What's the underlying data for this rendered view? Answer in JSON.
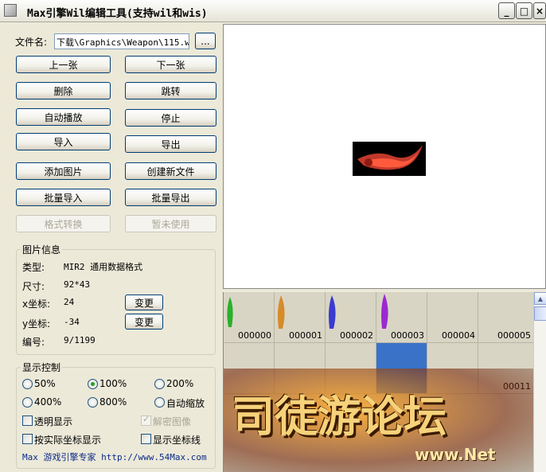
{
  "window": {
    "title": "Max引擎Wil编辑工具(支持wil和wis)",
    "minimize": "_",
    "maximize": "□",
    "close": "×"
  },
  "file": {
    "label": "文件名:",
    "path": "下载\\Graphics\\Weapon\\115.wil",
    "browse": "..."
  },
  "buttons": {
    "prev": "上一张",
    "next": "下一张",
    "delete": "删除",
    "jump": "跳转",
    "autoplay": "自动播放",
    "stop": "停止",
    "import": "导入",
    "export": "导出",
    "add_image": "添加图片",
    "new_file": "创建新文件",
    "batch_import": "批量导入",
    "batch_export": "批量导出",
    "format_convert": "格式转换",
    "unused": "暂未使用"
  },
  "info": {
    "title": "图片信息",
    "type_label": "类型:",
    "type_value": "MIR2  通用数据格式",
    "size_label": "尺寸:",
    "size_value": "92*43",
    "x_label": "x坐标:",
    "x_value": "24",
    "y_label": "y坐标:",
    "y_value": "-34",
    "index_label": "编号:",
    "index_value": "9/1199",
    "change": "变更"
  },
  "display": {
    "title": "显示控制",
    "z50": "50%",
    "z100": "100%",
    "z200": "200%",
    "z400": "400%",
    "z800": "800%",
    "auto": "自动缩放",
    "transparent": "透明显示",
    "decrypt": "解密图像",
    "actual_coords": "按实际坐标显示",
    "show_coords": "显示坐标线",
    "selected_zoom": "100%"
  },
  "footer": "Max 游戏引擎专家 http://www.54Max.com",
  "thumbnails": {
    "row1": [
      "000000",
      "000001",
      "000002",
      "000003",
      "000004",
      "000005"
    ],
    "row2_label": "00011"
  },
  "watermark": {
    "text": "司徒游论坛",
    "url": "www.Net"
  },
  "colors": {
    "selected_cell": "#3a72c8",
    "sprite_red": "#c0392b"
  }
}
